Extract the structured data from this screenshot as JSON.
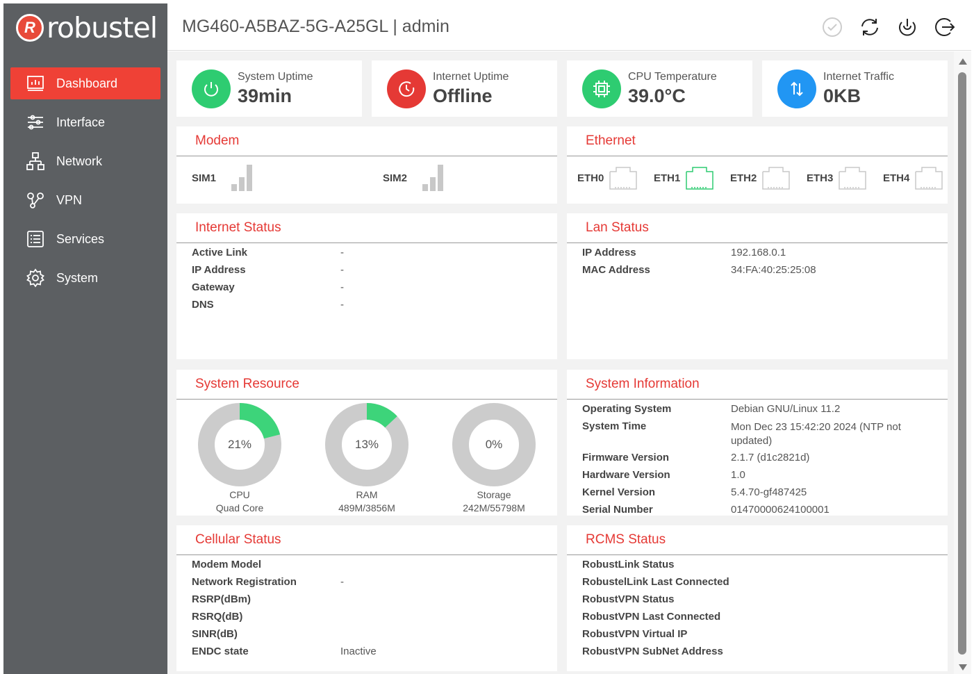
{
  "brand": {
    "logo_text": "robustel",
    "badge": "R"
  },
  "sidebar": {
    "items": [
      {
        "label": "Dashboard",
        "icon": "dashboard-icon",
        "active": true
      },
      {
        "label": "Interface",
        "icon": "sliders-icon"
      },
      {
        "label": "Network",
        "icon": "network-icon"
      },
      {
        "label": "VPN",
        "icon": "vpn-icon"
      },
      {
        "label": "Services",
        "icon": "services-icon"
      },
      {
        "label": "System",
        "icon": "gear-icon"
      }
    ]
  },
  "header": {
    "title": "MG460-A5BAZ-5G-A25GL | admin",
    "icons": [
      "check-circle-icon",
      "refresh-icon",
      "power-icon",
      "logout-icon"
    ]
  },
  "stats": [
    {
      "label": "System Uptime",
      "value": "39min",
      "color": "#2ecc71",
      "icon": "power-icon"
    },
    {
      "label": "Internet Uptime",
      "value": "Offline",
      "color": "#e53935",
      "icon": "clock-icon"
    },
    {
      "label": "CPU Temperature",
      "value": "39.0°C",
      "color": "#2ecc71",
      "icon": "chip-icon"
    },
    {
      "label": "Internet Traffic",
      "value": "0KB",
      "color": "#2196f3",
      "icon": "traffic-icon"
    }
  ],
  "modem": {
    "title": "Modem",
    "sims": [
      "SIM1",
      "SIM2"
    ]
  },
  "ethernet": {
    "title": "Ethernet",
    "ports": [
      {
        "name": "ETH0",
        "connected": false
      },
      {
        "name": "ETH1",
        "connected": true
      },
      {
        "name": "ETH2",
        "connected": false
      },
      {
        "name": "ETH3",
        "connected": false
      },
      {
        "name": "ETH4",
        "connected": false
      }
    ]
  },
  "internet_status": {
    "title": "Internet Status",
    "rows": [
      {
        "key": "Active Link",
        "value": "-"
      },
      {
        "key": "IP Address",
        "value": "-"
      },
      {
        "key": "Gateway",
        "value": "-"
      },
      {
        "key": "DNS",
        "value": "-"
      }
    ]
  },
  "lan_status": {
    "title": "Lan Status",
    "rows": [
      {
        "key": "IP Address",
        "value": "192.168.0.1"
      },
      {
        "key": "MAC Address",
        "value": "34:FA:40:25:25:08"
      }
    ]
  },
  "system_resource": {
    "title": "System Resource",
    "items": [
      {
        "percent_label": "21%",
        "percent": 21,
        "caption1": "CPU",
        "caption2": "Quad Core"
      },
      {
        "percent_label": "13%",
        "percent": 13,
        "caption1": "RAM",
        "caption2": "489M/3856M"
      },
      {
        "percent_label": "0%",
        "percent": 0,
        "caption1": "Storage",
        "caption2": "242M/55798M"
      }
    ],
    "fill_color": "#3dd47a",
    "track_color": "#cccccc"
  },
  "system_information": {
    "title": "System Information",
    "rows": [
      {
        "key": "Operating System",
        "value": "Debian GNU/Linux 11.2"
      },
      {
        "key": "System Time",
        "value": "Mon Dec 23 15:42:20 2024 (NTP not",
        "value2": "updated)"
      },
      {
        "key": "Firmware Version",
        "value": "2.1.7 (d1c2821d)"
      },
      {
        "key": "Hardware Version",
        "value": "1.0"
      },
      {
        "key": "Kernel Version",
        "value": "5.4.70-gf487425"
      },
      {
        "key": "Serial Number",
        "value": "01470000624100001"
      }
    ]
  },
  "cellular_status": {
    "title": "Cellular Status",
    "rows": [
      {
        "key": "Modem Model",
        "value": ""
      },
      {
        "key": "Network Registration",
        "value": "-"
      },
      {
        "key": "RSRP(dBm)",
        "value": ""
      },
      {
        "key": "RSRQ(dB)",
        "value": ""
      },
      {
        "key": "SINR(dB)",
        "value": ""
      },
      {
        "key": "ENDC state",
        "value": "Inactive"
      }
    ]
  },
  "rcms_status": {
    "title": "RCMS Status",
    "rows": [
      {
        "key": "RobustLink Status",
        "value": ""
      },
      {
        "key": "RobustelLink Last Connected",
        "value": ""
      },
      {
        "key": "RobustVPN Status",
        "value": ""
      },
      {
        "key": "RobustVPN Last Connected",
        "value": ""
      },
      {
        "key": "RobustVPN Virtual IP",
        "value": ""
      },
      {
        "key": "RobustVPN SubNet Address",
        "value": ""
      }
    ]
  }
}
